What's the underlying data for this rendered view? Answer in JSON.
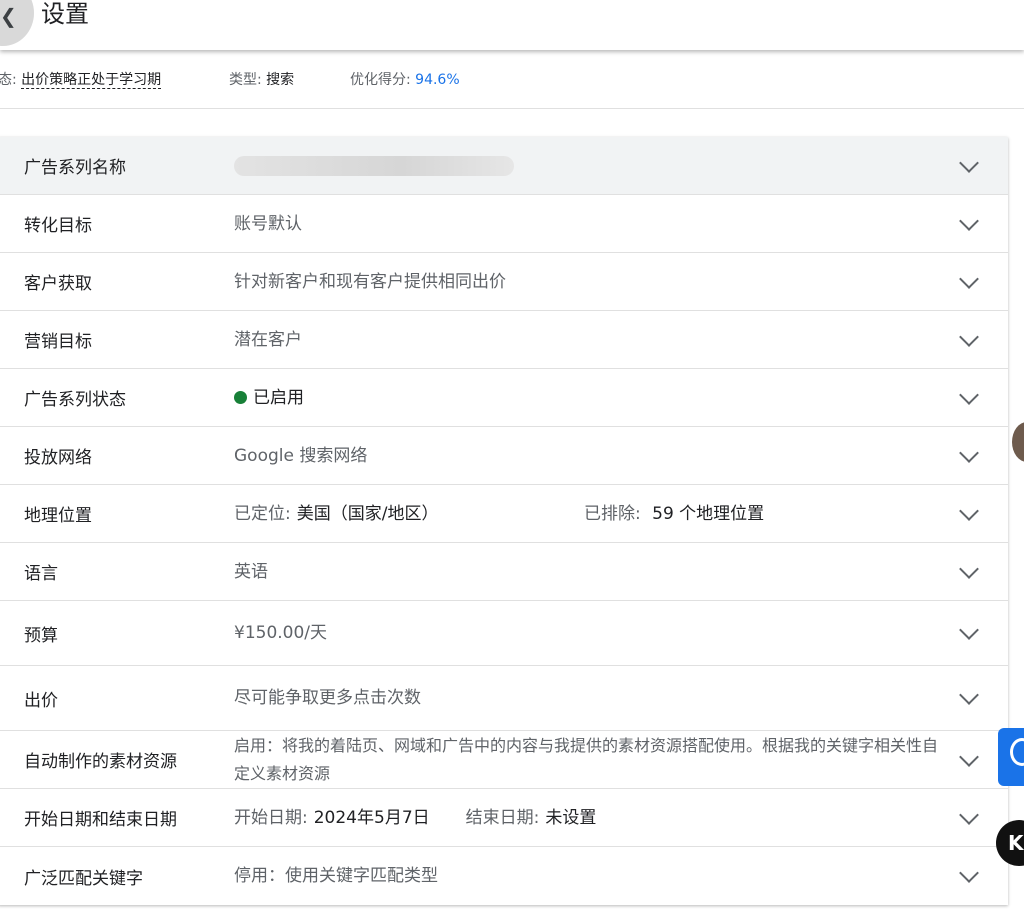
{
  "header": {
    "title": "设置"
  },
  "status": {
    "status_label": "态:",
    "status_value": "出价策略正处于学习期",
    "type_label": "类型:",
    "type_value": "搜索",
    "score_label": "优化得分:",
    "score_value": "94.6%"
  },
  "settings": [
    {
      "label": "广告系列名称",
      "value": ""
    },
    {
      "label": "转化目标",
      "value": "账号默认"
    },
    {
      "label": "客户获取",
      "value": "针对新客户和现有客户提供相同出价"
    },
    {
      "label": "营销目标",
      "value": "潜在客户"
    },
    {
      "label": "广告系列状态",
      "value": "已启用"
    },
    {
      "label": "投放网络",
      "value": "Google 搜索网络"
    },
    {
      "label": "地理位置",
      "targeted_label": "已定位:",
      "targeted_value": "美国（国家/地区）",
      "excluded_label": "已排除:",
      "excluded_value": "59 个地理位置"
    },
    {
      "label": "语言",
      "value": "英语"
    },
    {
      "label": "预算",
      "value": "¥150.00/天"
    },
    {
      "label": "出价",
      "value": "尽可能争取更多点击次数"
    },
    {
      "label": "自动制作的素材资源",
      "value": "启用：将我的着陆页、网域和广告中的内容与我提供的素材资源搭配使用。根据我的关键字相关性自定义素材资源"
    },
    {
      "label": "开始日期和结束日期",
      "start_label": "开始日期:",
      "start_value": "2024年5月7日",
      "end_label": "结束日期:",
      "end_value": "未设置"
    },
    {
      "label": "广泛匹配关键字",
      "value": "停用：使用关键字匹配类型"
    }
  ],
  "icons": {
    "back": "back-arrow-icon",
    "expand": "chevron-down-icon",
    "status": "status-dot-icon"
  },
  "colors": {
    "accent": "#1a73e8",
    "enabled": "#188038",
    "header_row_bg": "#f1f3f4"
  }
}
